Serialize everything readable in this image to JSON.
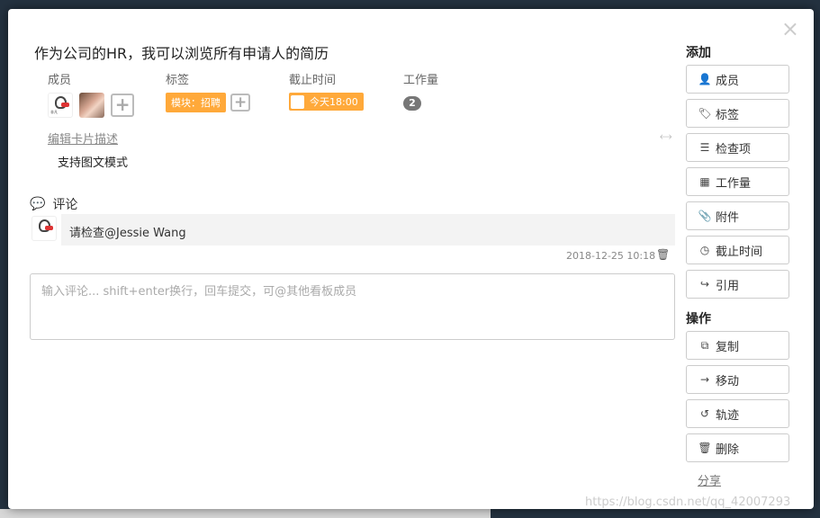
{
  "card": {
    "title": "作为公司的HR，我可以浏览所有申请人的简历",
    "close_label": "×"
  },
  "meta": {
    "members_label": "成员",
    "tags_label": "标签",
    "due_label": "截止时间",
    "work_label": "工作量",
    "tag_value": "模块：招聘",
    "due_value": "今天18:00",
    "work_value": "2",
    "add_symbol": "+",
    "avatar_caption": "非凡"
  },
  "description": {
    "edit_label": "编辑卡片描述",
    "text": "支持图文模式",
    "expand_icon": "⤢"
  },
  "comments": {
    "heading": "评论",
    "items": [
      {
        "text": "请检查@Jessie Wang",
        "time": "2018-12-25 10:18"
      }
    ],
    "input_placeholder": "输入评论... shift+enter换行，回车提交，可@其他看板成员"
  },
  "sidebar": {
    "add_heading": "添加",
    "add_buttons": [
      {
        "label": "成员",
        "icon": "user-plus-icon",
        "glyph": "👤"
      },
      {
        "label": "标签",
        "icon": "tag-icon",
        "glyph": "🏷"
      },
      {
        "label": "检查项",
        "icon": "list-icon",
        "glyph": "☰"
      },
      {
        "label": "工作量",
        "icon": "grid-icon",
        "glyph": "▦"
      },
      {
        "label": "附件",
        "icon": "paperclip-icon",
        "glyph": "📎"
      },
      {
        "label": "截止时间",
        "icon": "clock-icon",
        "glyph": "◷"
      },
      {
        "label": "引用",
        "icon": "share-arrow-icon",
        "glyph": "↪"
      }
    ],
    "ops_heading": "操作",
    "ops_buttons": [
      {
        "label": "复制",
        "icon": "copy-icon",
        "glyph": "⧉"
      },
      {
        "label": "移动",
        "icon": "arrow-right-icon",
        "glyph": "→"
      },
      {
        "label": "轨迹",
        "icon": "history-icon",
        "glyph": "↺"
      },
      {
        "label": "删除",
        "icon": "trash-icon",
        "glyph": "🗑"
      }
    ],
    "share_label": "分享"
  },
  "watermark": "https://blog.csdn.net/qq_42007293",
  "colors": {
    "tag_orange": "#ffa93a",
    "work_badge": "#777777"
  }
}
